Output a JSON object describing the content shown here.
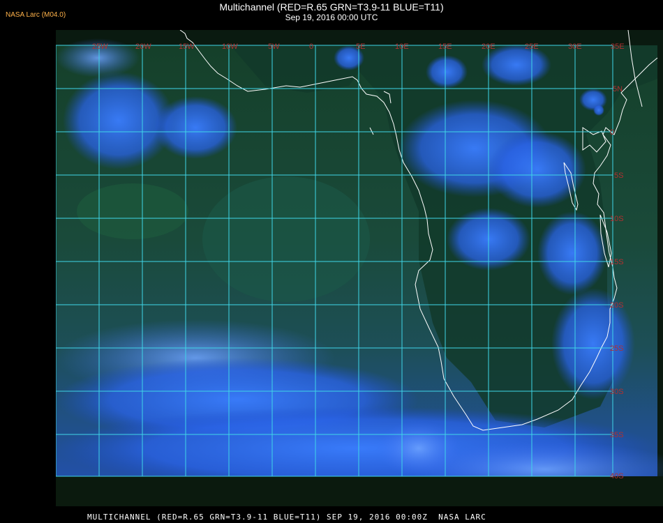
{
  "header": {
    "credit": "NASA Larc (M04.0)",
    "title": "Multichannel (RED=R.65 GRN=T3.9-11 BLUE=T11)",
    "subtitle": "Sep 19, 2016 00:00 UTC"
  },
  "map": {
    "lon_labels": [
      "25W",
      "20W",
      "15W",
      "10W",
      "5W",
      "0",
      "5E",
      "10E",
      "15E",
      "20E",
      "25E",
      "30E",
      "35E"
    ],
    "lat_labels": [
      "5N",
      "0",
      "5S",
      "10S",
      "15S",
      "20S",
      "25S",
      "30S",
      "35S",
      "40S"
    ],
    "colors": {
      "grid": "#3fd6e8",
      "coastline": "#ffffff",
      "labels": "#b23030",
      "ocean": "#0f3a22",
      "cloud": "#2f6bff"
    }
  },
  "footer": {
    "caption": "MULTICHANNEL (RED=R.65 GRN=T3.9-11 BLUE=T11) SEP 19, 2016 00:00Z  NASA LARC"
  }
}
